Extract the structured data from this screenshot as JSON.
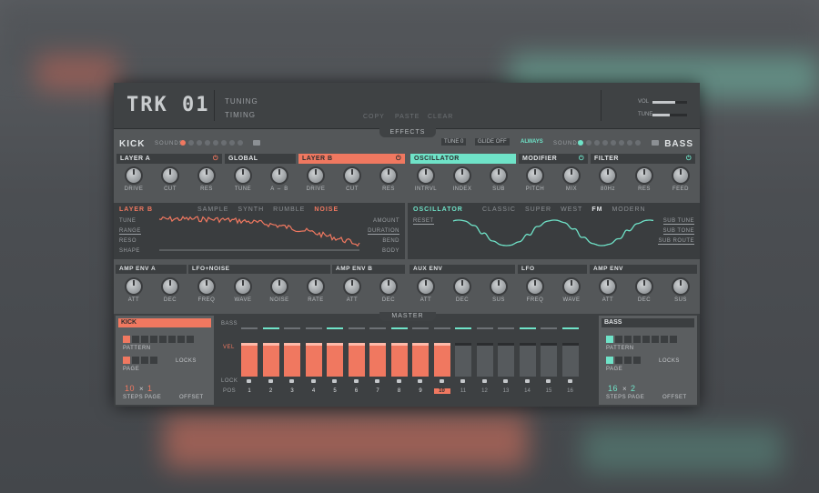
{
  "header": {
    "logo": "TRK 01",
    "links": [
      "TUNING",
      "TIMING"
    ],
    "actions": [
      "COPY",
      "PASTE",
      "CLEAR"
    ],
    "vol_label": "VOL",
    "vol_level": 0.65,
    "tune_label": "TUNE",
    "tune_level": 0.5
  },
  "effects_tab": "EFFECTS",
  "master_tab": "MASTER",
  "kick": {
    "title": "KICK",
    "sounds_label": "SOUNDS",
    "tabs": [
      "LAYER A",
      "GLOBAL",
      "LAYER B"
    ],
    "knobs": [
      "DRIVE",
      "CUT",
      "RES",
      "TUNE",
      "A ⇔ B",
      "DRIVE",
      "CUT",
      "RES"
    ],
    "layer_panel": {
      "active": "LAYER B",
      "modes": [
        "SAMPLE",
        "SYNTH",
        "RUMBLE",
        "NOISE"
      ],
      "selected_mode": "NOISE",
      "left_params": [
        "TUNE",
        "RANGE",
        "RESO",
        "SHAPE"
      ],
      "right_params": [
        "AMOUNT",
        "DURATION",
        "BEND",
        "BODY"
      ]
    },
    "env_tabs": [
      "AMP ENV A",
      "LFO+NOISE",
      "AMP ENV B"
    ],
    "env_knobs": [
      "ATT",
      "DEC",
      "FREQ",
      "WAVE",
      "NOISE",
      "RATE",
      "ATT",
      "DEC"
    ]
  },
  "bass": {
    "title": "BASS",
    "sounds_label": "SOUNDS",
    "tune_label": "TUNE",
    "tune_value": "0",
    "glide_label": "GLIDE",
    "glide_value": "OFF",
    "always_label": "ALWAYS",
    "tabs": [
      "OSCILLATOR",
      "MODIFIER",
      "FILTER"
    ],
    "knobs": [
      "INTRVL",
      "INDEX",
      "SUB",
      "PITCH",
      "MIX",
      "80Hz",
      "RES",
      "FEED"
    ],
    "osc_panel": {
      "active": "OSCILLATOR",
      "modes": [
        "CLASSIC",
        "SUPER",
        "WEST",
        "FM",
        "MODERN"
      ],
      "selected_mode": "FM",
      "left_params": [
        "RESET"
      ],
      "right_params": [
        "SUB TUNE",
        "SUB TONE",
        "SUB ROUTE"
      ]
    },
    "env_tabs": [
      "AUX ENV",
      "LFO",
      "AMP ENV"
    ],
    "env_knobs": [
      "ATT",
      "DEC",
      "SUS",
      "FREQ",
      "WAVE",
      "ATT",
      "DEC",
      "SUS"
    ]
  },
  "sequencer": {
    "lane_label": "BASS",
    "vel_label": "VEL",
    "lock_label": "LOCK",
    "pos_label": "POS",
    "steps": [
      1,
      2,
      3,
      4,
      5,
      6,
      7,
      8,
      9,
      10,
      11,
      12,
      13,
      14,
      15,
      16
    ],
    "active_steps": 10,
    "current_step": 10
  },
  "kick_channel": {
    "name": "KICK",
    "pattern_label": "PATTERN",
    "page_label": "PAGE",
    "locks_label": "LOCKS",
    "steps_value": "10",
    "page_value": "1",
    "steps_label": "STEPS",
    "page_label2": "PAGE",
    "offset_label": "OFFSET"
  },
  "bass_channel": {
    "name": "BASS",
    "pattern_label": "PATTERN",
    "page_label": "PAGE",
    "locks_label": "LOCKS",
    "steps_value": "16",
    "page_value": "2",
    "steps_label": "STEPS",
    "page_label2": "PAGE",
    "offset_label": "OFFSET"
  },
  "colors": {
    "kick_accent": "#f07860",
    "bass_accent": "#6fe3c8"
  }
}
